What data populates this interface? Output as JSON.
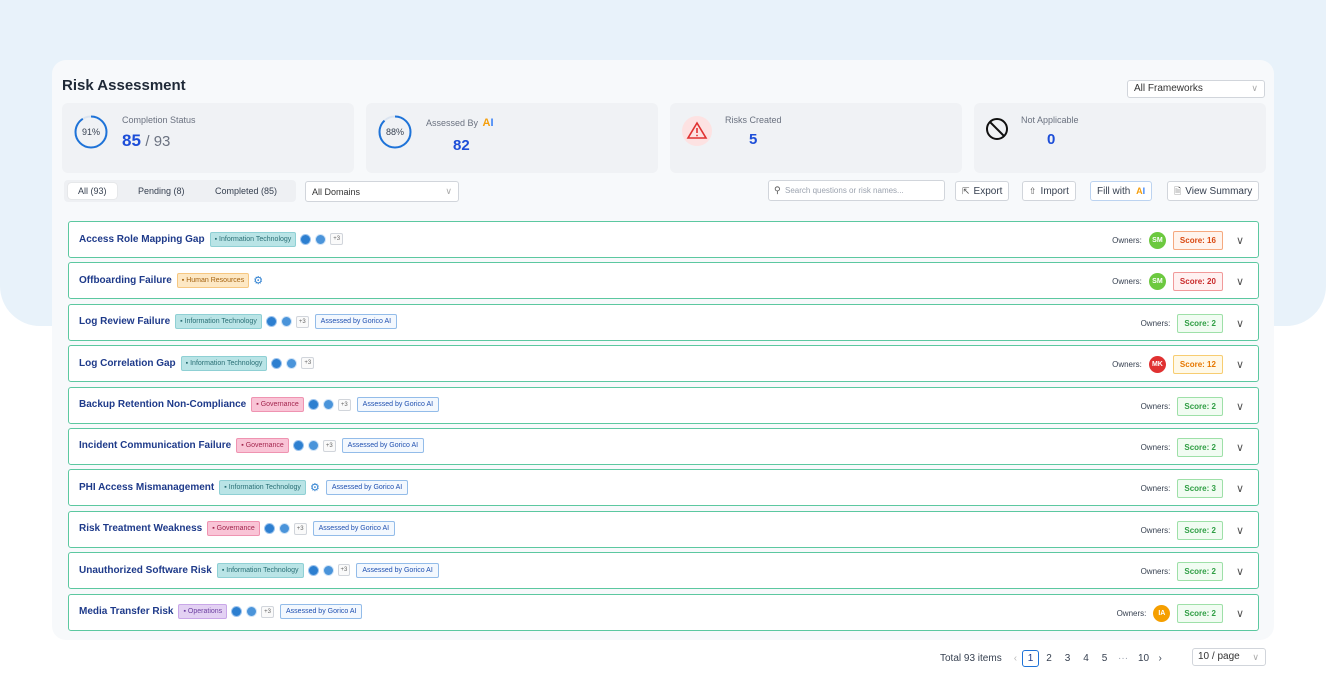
{
  "header": {
    "title": "Risk Assessment",
    "framework_select": "All Frameworks"
  },
  "stats": {
    "completion": {
      "label": "Completion Status",
      "percent": "91%",
      "value": "85",
      "total": "/ 93",
      "fraction": 0.91
    },
    "assessed": {
      "label": "Assessed By",
      "percent": "88%",
      "value": "82",
      "fraction": 0.88
    },
    "risks": {
      "label": "Risks Created",
      "value": "5"
    },
    "na": {
      "label": "Not Applicable",
      "value": "0"
    }
  },
  "tabs": [
    {
      "label": "All (93)",
      "active": true
    },
    {
      "label": "Pending (8)",
      "active": false
    },
    {
      "label": "Completed (85)",
      "active": false
    }
  ],
  "domain_select": "All Domains",
  "search": {
    "placeholder": "Search questions or risk names..."
  },
  "toolbar": {
    "export": "Export",
    "import": "Import",
    "fill_with": "Fill with",
    "view_summary": "View Summary"
  },
  "owners_label": "Owners:",
  "rows": [
    {
      "name": "Access Role Mapping Gap",
      "tag": "Information Technology",
      "tag_type": "it",
      "plus": "+3",
      "assessed": "",
      "owner": "SM",
      "owner_color": "#6cc93f",
      "score": "Score: 16",
      "score_type": "orange",
      "icons": "dots"
    },
    {
      "name": "Offboarding Failure",
      "tag": "Human Resources",
      "tag_type": "hr",
      "plus": "",
      "assessed": "",
      "owner": "SM",
      "owner_color": "#6cc93f",
      "score": "Score: 20",
      "score_type": "red",
      "icons": "gear"
    },
    {
      "name": "Log Review Failure",
      "tag": "Information Technology",
      "tag_type": "it",
      "plus": "+3",
      "assessed": "Assessed by Gorico AI",
      "owner": "",
      "owner_color": "",
      "score": "Score: 2",
      "score_type": "green",
      "icons": "dots"
    },
    {
      "name": "Log Correlation Gap",
      "tag": "Information Technology",
      "tag_type": "it",
      "plus": "+3",
      "assessed": "",
      "owner": "MK",
      "owner_color": "#e03131",
      "score": "Score: 12",
      "score_type": "amber",
      "icons": "dots"
    },
    {
      "name": "Backup Retention Non-Compliance",
      "tag": "Governance",
      "tag_type": "gov",
      "plus": "+3",
      "assessed": "Assessed by Gorico AI",
      "owner": "",
      "owner_color": "",
      "score": "Score: 2",
      "score_type": "green",
      "icons": "dots"
    },
    {
      "name": "Incident Communication Failure",
      "tag": "Governance",
      "tag_type": "gov",
      "plus": "+3",
      "assessed": "Assessed by Gorico AI",
      "owner": "",
      "owner_color": "",
      "score": "Score: 2",
      "score_type": "green",
      "icons": "dots"
    },
    {
      "name": "PHI Access Mismanagement",
      "tag": "Information Technology",
      "tag_type": "it",
      "plus": "",
      "assessed": "Assessed by Gorico AI",
      "owner": "",
      "owner_color": "",
      "score": "Score: 3",
      "score_type": "green",
      "icons": "gear"
    },
    {
      "name": "Risk Treatment Weakness",
      "tag": "Governance",
      "tag_type": "gov",
      "plus": "+3",
      "assessed": "Assessed by Gorico AI",
      "owner": "",
      "owner_color": "",
      "score": "Score: 2",
      "score_type": "green",
      "icons": "dots"
    },
    {
      "name": "Unauthorized Software Risk",
      "tag": "Information Technology",
      "tag_type": "it",
      "plus": "+3",
      "assessed": "Assessed by Gorico AI",
      "owner": "",
      "owner_color": "",
      "score": "Score: 2",
      "score_type": "green",
      "icons": "dots"
    },
    {
      "name": "Media Transfer Risk",
      "tag": "Operations",
      "tag_type": "ops",
      "plus": "+3",
      "assessed": "Assessed by Gorico AI",
      "owner": "IA",
      "owner_color": "#f59f00",
      "score": "Score: 2",
      "score_type": "green",
      "icons": "dots"
    }
  ],
  "pagination": {
    "total": "Total 93 items",
    "pages": [
      "1",
      "2",
      "3",
      "4",
      "5",
      "···",
      "10"
    ],
    "active": "1",
    "page_size": "10 / page"
  }
}
